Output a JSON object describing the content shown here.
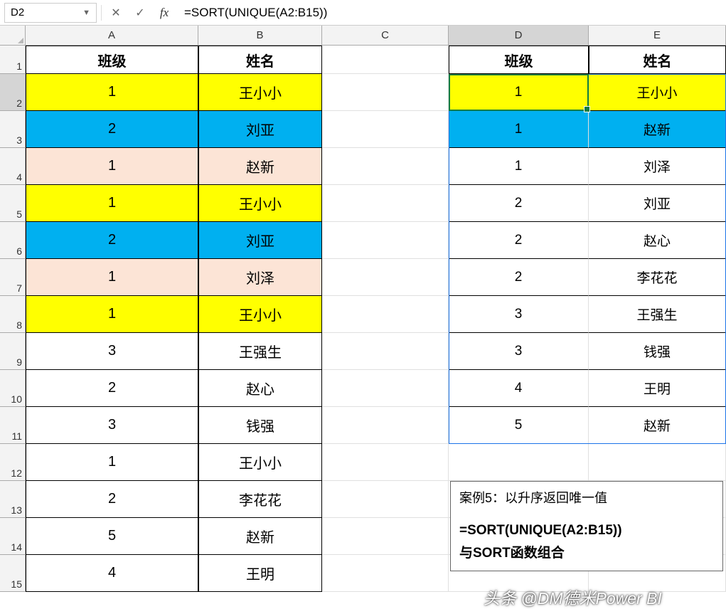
{
  "nameBox": "D2",
  "formula": "=SORT(UNIQUE(A2:B15))",
  "columns": [
    "A",
    "B",
    "C",
    "D",
    "E"
  ],
  "rowNums": [
    "1",
    "2",
    "3",
    "4",
    "5",
    "6",
    "7",
    "8",
    "9",
    "10",
    "11",
    "12",
    "13",
    "14",
    "15"
  ],
  "left": {
    "headers": {
      "class": "班级",
      "name": "姓名"
    },
    "rows": [
      {
        "c": "1",
        "n": "王小小",
        "fill": "yellow"
      },
      {
        "c": "2",
        "n": "刘亚",
        "fill": "blue"
      },
      {
        "c": "1",
        "n": "赵新",
        "fill": "beige"
      },
      {
        "c": "1",
        "n": "王小小",
        "fill": "yellow"
      },
      {
        "c": "2",
        "n": "刘亚",
        "fill": "blue"
      },
      {
        "c": "1",
        "n": "刘泽",
        "fill": "beige"
      },
      {
        "c": "1",
        "n": "王小小",
        "fill": "yellow"
      },
      {
        "c": "3",
        "n": "王强生",
        "fill": ""
      },
      {
        "c": "2",
        "n": "赵心",
        "fill": ""
      },
      {
        "c": "3",
        "n": "钱强",
        "fill": ""
      },
      {
        "c": "1",
        "n": "王小小",
        "fill": ""
      },
      {
        "c": "2",
        "n": "李花花",
        "fill": ""
      },
      {
        "c": "5",
        "n": "赵新",
        "fill": ""
      },
      {
        "c": "4",
        "n": "王明",
        "fill": ""
      }
    ]
  },
  "right": {
    "headers": {
      "class": "班级",
      "name": "姓名"
    },
    "rows": [
      {
        "c": "1",
        "n": "王小小",
        "fill": "yellow"
      },
      {
        "c": "1",
        "n": "赵新",
        "fill": "blue"
      },
      {
        "c": "1",
        "n": "刘泽",
        "fill": ""
      },
      {
        "c": "2",
        "n": "刘亚",
        "fill": ""
      },
      {
        "c": "2",
        "n": "赵心",
        "fill": ""
      },
      {
        "c": "2",
        "n": "李花花",
        "fill": ""
      },
      {
        "c": "3",
        "n": "王强生",
        "fill": ""
      },
      {
        "c": "3",
        "n": "钱强",
        "fill": ""
      },
      {
        "c": "4",
        "n": "王明",
        "fill": ""
      },
      {
        "c": "5",
        "n": "赵新",
        "fill": ""
      }
    ]
  },
  "note": {
    "line1": "案例5：以升序返回唯一值",
    "line2": "=SORT(UNIQUE(A2:B15))",
    "line3": "与SORT函数组合"
  },
  "watermark": "头条 @DM德米Power BI",
  "rowHeights": {
    "hdr": 40,
    "data": 52
  }
}
